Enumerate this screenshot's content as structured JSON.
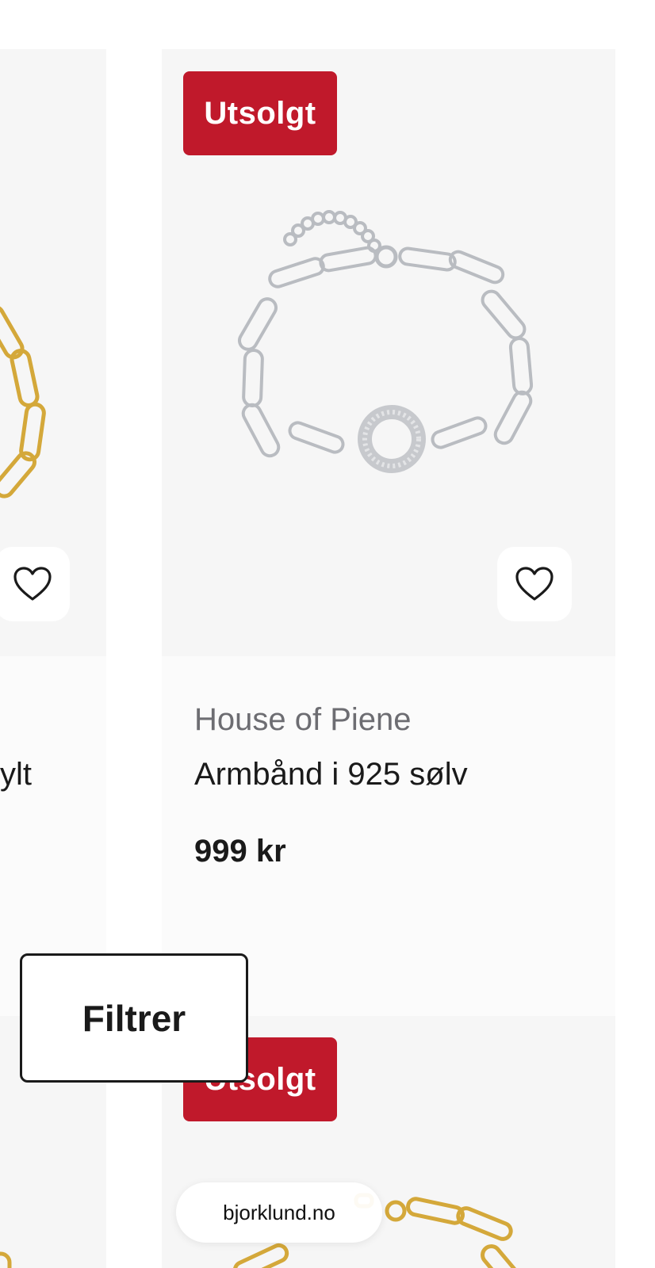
{
  "products": [
    {
      "brand": "",
      "name_fragment": "ylt",
      "favorite_icon": "heart-outline-icon",
      "image": "gold-paperclip-chain-bracelet"
    },
    {
      "badge": "Utsolgt",
      "brand": "House of Piene",
      "name": "Armbånd i 925 sølv",
      "price": "999 kr",
      "favorite_icon": "heart-outline-icon",
      "image": "silver-paperclip-chain-bracelet-with-pave-circle"
    },
    {
      "badge": "Utsolgt",
      "image": "gold-paperclip-chain-bracelet"
    }
  ],
  "filter_button": {
    "label": "Filtrer"
  },
  "browser": {
    "domain": "bjorklund.no"
  },
  "colors": {
    "badge": "#c0192b",
    "brand_text": "#6d6d72",
    "card_bg": "#f6f6f6"
  }
}
